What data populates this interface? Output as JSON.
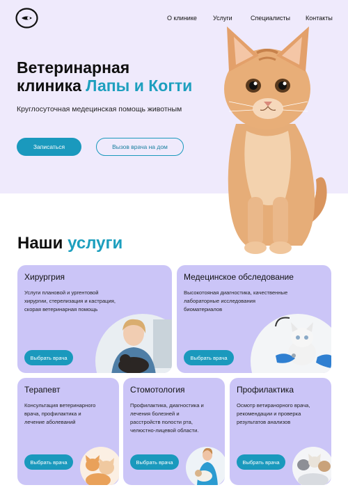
{
  "nav": {
    "items": [
      "О клинике",
      "Услуги",
      "Специалисты",
      "Контакты"
    ]
  },
  "hero": {
    "title_line1": "Ветеринарная",
    "title_line2_plain": "клиника ",
    "title_line2_accent": "Лапы и Когти",
    "subtitle": "Круглосуточная медецинская помощь  животным",
    "primary_button": "Записаться",
    "secondary_button": "Вызов врача на дом"
  },
  "services": {
    "title_plain": "Наши ",
    "title_accent": "услуги",
    "cards": [
      {
        "title": "Хирургрия",
        "desc1": "Услуги плановой и ургентовой",
        "desc2": "хирургии, стерелизация и кастрация,",
        "desc3": "скорая ветеринарная помощь",
        "button": "Выбрать врача",
        "image": "vet-holding-cat"
      },
      {
        "title": "Медецинское обследование",
        "desc1": "Высокотояная диагностика, качественные",
        "desc2": "лабораторные исследования",
        "desc3": "биоматериалов",
        "button": "Выбрать врача",
        "image": "vet-examining-kitten"
      },
      {
        "title": "Терапевт",
        "desc1": "Консультация ветеринарного",
        "desc2": "врача, профилактика и",
        "desc3": "лечение аболеваний",
        "button": "Выбрать врача",
        "image": "kittens"
      },
      {
        "title": "Стомотология",
        "desc1": "Профилактика, диагностика и",
        "desc2": "лечения болезней и",
        "desc3": "расстройств полости рта,",
        "desc4": "челюстно-лицевой области.",
        "button": "Выбрать врача",
        "image": "vet-with-dog"
      },
      {
        "title": "Профилактика",
        "desc1": "Осмотр ветиранорного врача,",
        "desc2": "рекомендации и проверка",
        "desc3": "результатов анализов",
        "button": "Выбрать врача",
        "image": "kittens-group"
      }
    ]
  },
  "colors": {
    "accent": "#1d9fbe",
    "hero_bg": "#efeafc",
    "card_bg": "#cbc5f7"
  }
}
